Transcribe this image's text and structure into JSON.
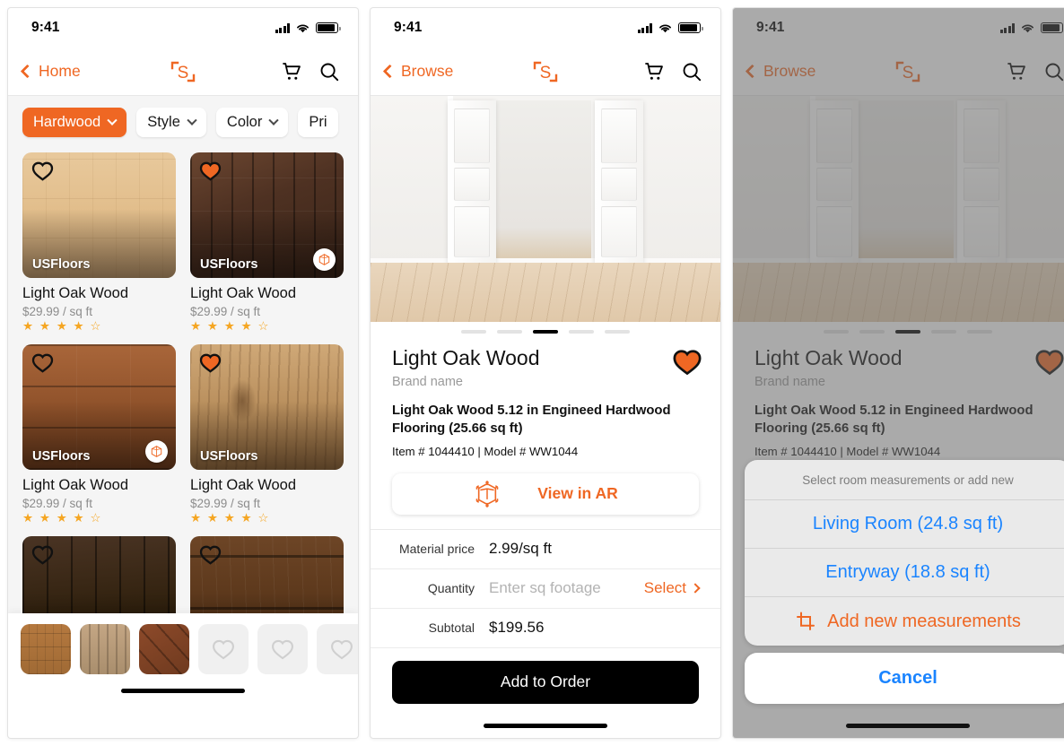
{
  "status_bar": {
    "time": "9:41",
    "signal_icon": "cellular-bars-icon",
    "wifi_icon": "wifi-icon",
    "battery_icon": "battery-icon"
  },
  "brand": {
    "logo": "s-logo-icon"
  },
  "panel1": {
    "nav": {
      "back_label": "Home",
      "cart_icon": "cart-icon",
      "search_icon": "search-icon"
    },
    "filters": [
      {
        "label": "Hardwood",
        "active": true
      },
      {
        "label": "Style",
        "active": false
      },
      {
        "label": "Color",
        "active": false
      },
      {
        "label": "Pri",
        "active": false
      }
    ],
    "products": [
      {
        "brand": "USFloors",
        "title": "Light Oak Wood",
        "price": "$29.99 / sq ft",
        "stars": "★ ★ ★ ★ ☆",
        "favorited": false,
        "has_ar": false,
        "swatch": "w-lightoak"
      },
      {
        "brand": "USFloors",
        "title": "Light Oak Wood",
        "price": "$29.99 / sq ft",
        "stars": "★ ★ ★ ★ ☆",
        "favorited": true,
        "has_ar": true,
        "swatch": "w-darkplank"
      },
      {
        "brand": "USFloors",
        "title": "Light Oak Wood",
        "price": "$29.99 / sq ft",
        "stars": "★ ★ ★ ★ ☆",
        "favorited": false,
        "has_ar": true,
        "swatch": "w-cherry"
      },
      {
        "brand": "USFloors",
        "title": "Light Oak Wood",
        "price": "$29.99 / sq ft",
        "stars": "★ ★ ★ ★ ☆",
        "favorited": true,
        "has_ar": false,
        "swatch": "w-grain"
      },
      {
        "brand": "",
        "title": "",
        "price": "",
        "stars": "",
        "favorited": false,
        "has_ar": false,
        "swatch": "w-espresso"
      },
      {
        "brand": "",
        "title": "",
        "price": "",
        "stars": "",
        "favorited": false,
        "has_ar": false,
        "swatch": "w-walnut"
      }
    ],
    "tray": {
      "swatches": [
        "w-sw1",
        "w-sw2",
        "w-sw3"
      ],
      "empty_slots": 3,
      "empty_icon": "heart-outline-icon"
    }
  },
  "panel2": {
    "nav": {
      "back_label": "Browse",
      "cart_icon": "cart-icon",
      "search_icon": "search-icon"
    },
    "carousel": {
      "total": 5,
      "active_index": 2
    },
    "product": {
      "title": "Light Oak Wood",
      "brand": "Brand name",
      "description": "Light Oak Wood 5.12 in Engineed Hardwood Flooring (25.66 sq ft)",
      "meta": "Item # 1044410  |  Model # WW1044",
      "favorited": true
    },
    "ar_button": {
      "label": "View in AR",
      "icon": "ar-cube-icon"
    },
    "rows": [
      {
        "label": "Material price",
        "value": "2.99/sq ft",
        "placeholder": false,
        "action": ""
      },
      {
        "label": "Quantity",
        "value": "Enter sq footage",
        "placeholder": true,
        "action": "Select"
      },
      {
        "label": "Subtotal",
        "value": "$199.56",
        "placeholder": false,
        "action": ""
      }
    ],
    "cta": {
      "label": "Add to Order"
    }
  },
  "panel3": {
    "nav": {
      "back_label": "Browse",
      "cart_icon": "cart-icon",
      "search_icon": "search-icon"
    },
    "action_sheet": {
      "title": "Select room measurements or add new",
      "options": [
        {
          "label": "Living Room (24.8 sq ft)",
          "accent": false
        },
        {
          "label": "Entryway (18.8 sq ft)",
          "accent": false
        },
        {
          "label": "Add new measurements",
          "accent": true,
          "icon": "crop-measure-icon"
        }
      ],
      "cancel_label": "Cancel"
    }
  },
  "colors": {
    "accent": "#EF6723",
    "link": "#1A84FF",
    "star": "#F5A623",
    "cta": "#000000",
    "sheet_bg": "#EAEAEA"
  }
}
